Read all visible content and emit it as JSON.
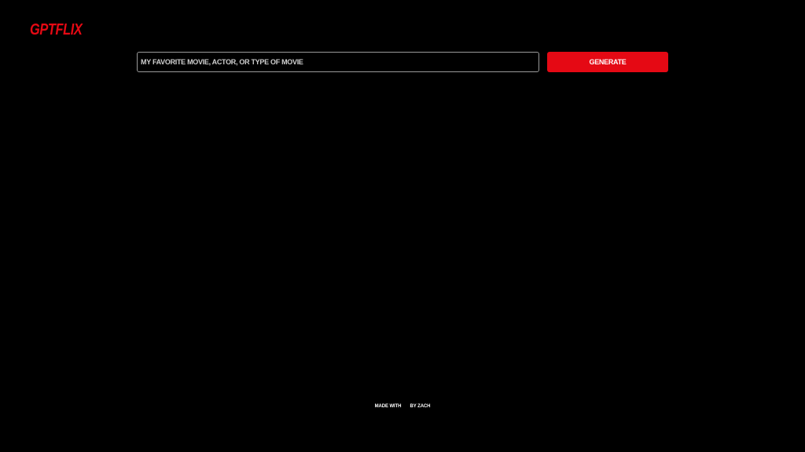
{
  "header": {
    "logo_text": "GPTFLIX"
  },
  "search": {
    "placeholder": "MY FAVORITE MOVIE, ACTOR, OR TYPE OF MOVIE",
    "value": "",
    "generate_label": "GENERATE"
  },
  "footer": {
    "made_with": "MADE WITH",
    "by_author": "BY ZACH"
  },
  "colors": {
    "background": "#000000",
    "brand": "#e50914",
    "text": "#ffffff",
    "input_border": "#9a9a9a"
  }
}
